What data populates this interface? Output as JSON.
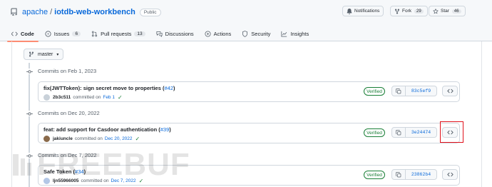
{
  "repo": {
    "owner": "apache",
    "separator": "/",
    "name": "iotdb-web-workbench",
    "visibility": "Public"
  },
  "header_buttons": {
    "notifications": "Notifications",
    "fork": {
      "label": "Fork",
      "count": "29"
    },
    "star": {
      "label": "Star",
      "count": "46"
    }
  },
  "tabs": [
    {
      "label": "Code",
      "icon": "code-icon",
      "active": true
    },
    {
      "label": "Issues",
      "count": "6",
      "icon": "issue-icon"
    },
    {
      "label": "Pull requests",
      "count": "13",
      "icon": "pull-request-icon"
    },
    {
      "label": "Discussions",
      "icon": "discussion-icon"
    },
    {
      "label": "Actions",
      "icon": "play-icon"
    },
    {
      "label": "Security",
      "icon": "shield-icon"
    },
    {
      "label": "Insights",
      "icon": "graph-icon"
    }
  ],
  "branch": {
    "label": "master"
  },
  "groups": [
    {
      "day": "Commits on Feb 1, 2023",
      "commit": {
        "title": "fix(JWTToken): sign secret move to properties (",
        "pr": "#42",
        "pr_close": ")",
        "author": "2b3c511",
        "committed_text": "committed on",
        "date": "Feb 1",
        "verified": "Verified",
        "sha": "83c5ef9"
      }
    },
    {
      "day": "Commits on Dec 20, 2022",
      "commit": {
        "title": "feat: add support for Casdoor authentication (",
        "pr": "#39",
        "pr_close": ")",
        "author": "jakiuncle",
        "committed_text": "committed on",
        "date": "Dec 20, 2022",
        "verified": "Verified",
        "sha": "3e24474"
      }
    },
    {
      "day": "Commits on Dec 7, 2022",
      "commit": {
        "title": "Safe Token (",
        "pr": "#34",
        "pr_close": ")",
        "author": "ljn55966005",
        "committed_text": "committed on",
        "date": "Dec 7, 2022",
        "verified": "Verified",
        "sha": "23862b4"
      }
    }
  ],
  "watermark": "FREEBUF",
  "colors": {
    "link": "#0969da",
    "verified": "#1a7f37",
    "highlight": "#e0101a",
    "active_tab": "#fd8c73"
  }
}
